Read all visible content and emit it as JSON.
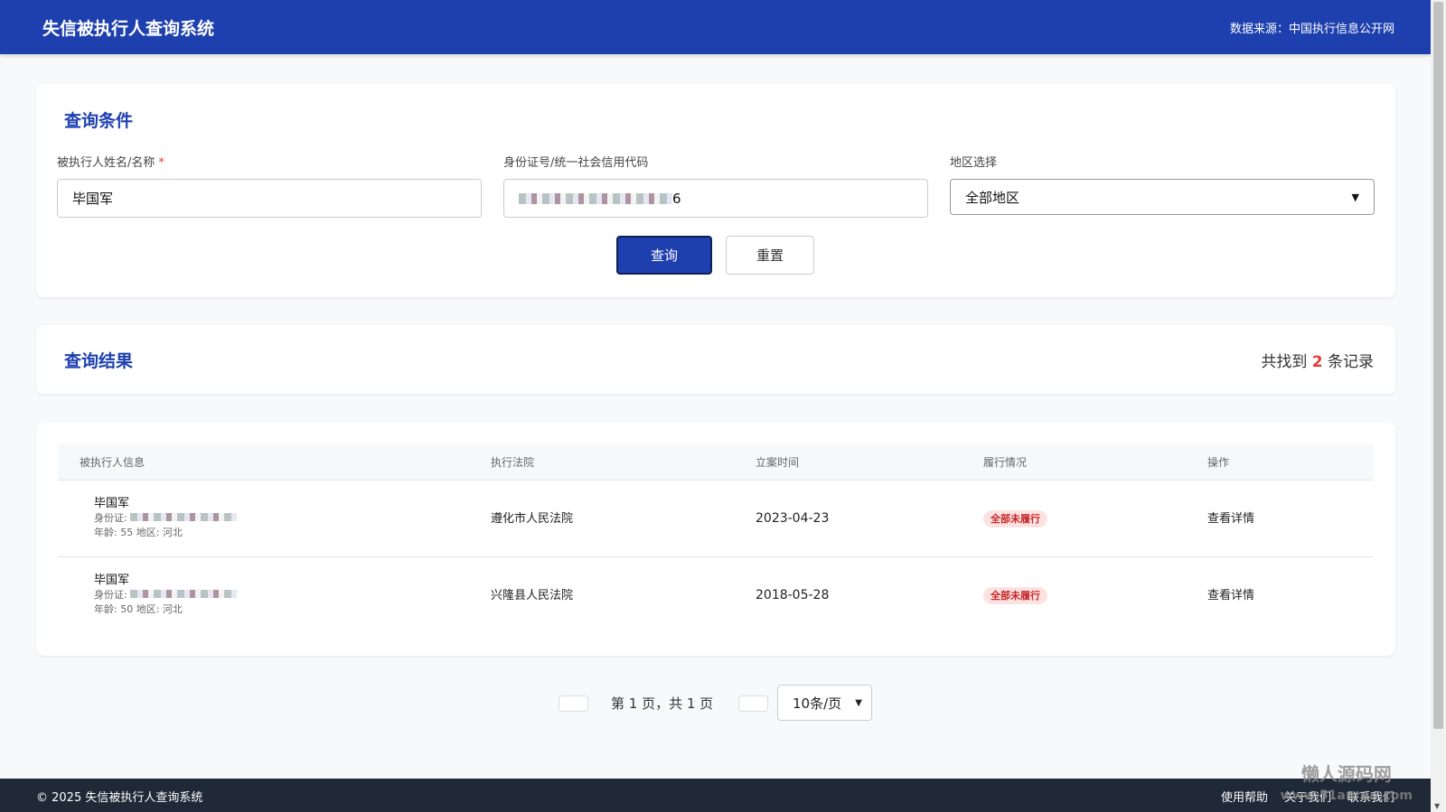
{
  "header": {
    "title": "失信被执行人查询系统",
    "source": "数据来源：中国执行信息公开网"
  },
  "search": {
    "title": "查询条件",
    "name_label": "被执行人姓名/名称",
    "required": "*",
    "name_value": "毕国军",
    "id_label": "身份证号/统一社会信用代码",
    "id_tail": "6",
    "region_label": "地区选择",
    "region_value": "全部地区",
    "query": "查询",
    "reset": "重置"
  },
  "results": {
    "title": "查询结果",
    "count_prefix": "共找到",
    "count": "2",
    "count_suffix": "条记录"
  },
  "table": {
    "headers": [
      "被执行人信息",
      "执行法院",
      "立案时间",
      "履行情况",
      "操作"
    ],
    "id_prefix": "身份证:",
    "rows": [
      {
        "name": "毕国军",
        "meta": "年龄: 55 地区: 河北",
        "court": "遵化市人民法院",
        "date": "2023-04-23",
        "status": "全部未履行",
        "action": "查看详情"
      },
      {
        "name": "毕国军",
        "meta": "年龄: 50 地区: 河北",
        "court": "兴隆县人民法院",
        "date": "2018-05-28",
        "status": "全部未履行",
        "action": "查看详情"
      }
    ]
  },
  "pager": {
    "text": "第 1 页，共 1 页",
    "page_size": "10条/页"
  },
  "footer": {
    "copyright": "© 2025 失信被执行人查询系统",
    "links": [
      "使用帮助",
      "关于我们",
      "联系我们"
    ]
  },
  "watermark": {
    "name": "懒人源码网",
    "url": "www.51anren.com"
  }
}
